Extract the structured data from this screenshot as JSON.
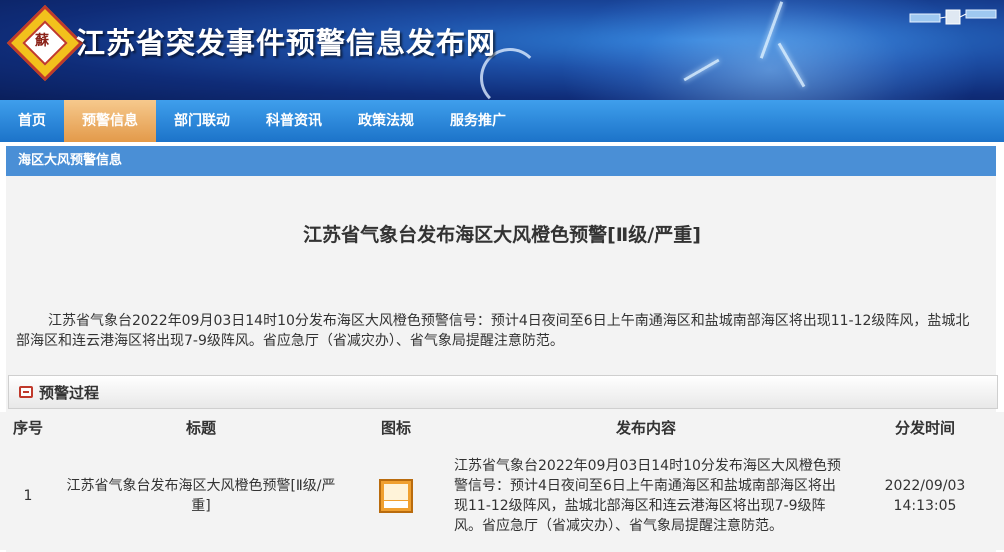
{
  "header": {
    "site_title": "江苏省突发事件预警信息发布网",
    "logo_char": "蘇"
  },
  "nav": {
    "items": [
      {
        "label": "首页",
        "active": false
      },
      {
        "label": "预警信息",
        "active": true
      },
      {
        "label": "部门联动",
        "active": false
      },
      {
        "label": "科普资讯",
        "active": false
      },
      {
        "label": "政策法规",
        "active": false
      },
      {
        "label": "服务推广",
        "active": false
      }
    ]
  },
  "section": {
    "title": "海区大风预警信息"
  },
  "article": {
    "title": "江苏省气象台发布海区大风橙色预警[Ⅱ级/严重]",
    "body": "江苏省气象台2022年09月03日14时10分发布海区大风橙色预警信号：预计4日夜间至6日上午南通海区和盐城南部海区将出现11-12级阵风，盐城北部海区和连云港海区将出现7-9级阵风。省应急厅（省减灾办）、省气象局提醒注意防范。"
  },
  "process": {
    "title": "预警过程",
    "columns": [
      "序号",
      "标题",
      "图标",
      "发布内容",
      "分发时间"
    ],
    "rows": [
      {
        "index": "1",
        "title": "江苏省气象台发布海区大风橙色预警[Ⅱ级/严重]",
        "icon": "orange-wind-warning-icon",
        "content": "江苏省气象台2022年09月03日14时10分发布海区大风橙色预警信号：预计4日夜间至6日上午南通海区和盐城南部海区将出现11-12级阵风，盐城北部海区和连云港海区将出现7-9级阵风。省应急厅（省减灾办）、省气象局提醒注意防范。",
        "date": "2022/09/03",
        "time": "14:13:05"
      }
    ]
  },
  "colors": {
    "nav_blue": "#1c73c9",
    "nav_active": "#e39a4a",
    "section_bar": "#4a8fd6",
    "warning_orange": "#f0a030"
  }
}
